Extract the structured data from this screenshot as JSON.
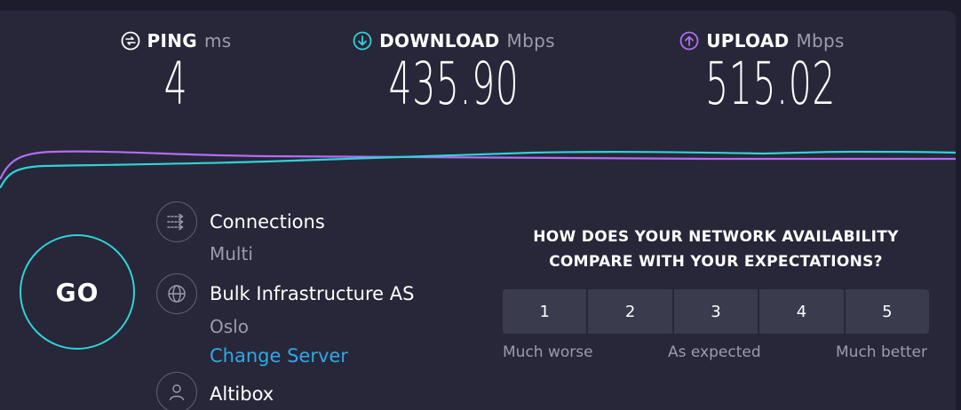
{
  "metrics": {
    "ping": {
      "label": "PING",
      "unit": "ms",
      "value": "4",
      "icon": "ping-icon"
    },
    "download": {
      "label": "DOWNLOAD",
      "unit": "Mbps",
      "value": "435.90",
      "icon": "download-arrow-icon",
      "color": "#2fd3d8"
    },
    "upload": {
      "label": "UPLOAD",
      "unit": "Mbps",
      "value": "515.02",
      "icon": "upload-arrow-icon",
      "color": "#b26ef0"
    }
  },
  "go_label": "GO",
  "connections": {
    "title": "Connections",
    "value": "Multi",
    "icon": "connections-arrows-icon"
  },
  "server": {
    "title": "Bulk Infrastructure AS",
    "location": "Oslo",
    "change_link": "Change Server",
    "icon": "globe-icon"
  },
  "provider": {
    "title": "Altibox",
    "icon": "user-icon"
  },
  "survey": {
    "question_line1": "HOW DOES YOUR NETWORK AVAILABILITY",
    "question_line2": "COMPARE WITH YOUR EXPECTATIONS?",
    "options": [
      "1",
      "2",
      "3",
      "4",
      "5"
    ],
    "label_low": "Much worse",
    "label_mid": "As expected",
    "label_high": "Much better"
  },
  "colors": {
    "accent": "#2fd3d8",
    "upload": "#b26ef0",
    "link": "#2da9e8",
    "background": "#272739"
  }
}
